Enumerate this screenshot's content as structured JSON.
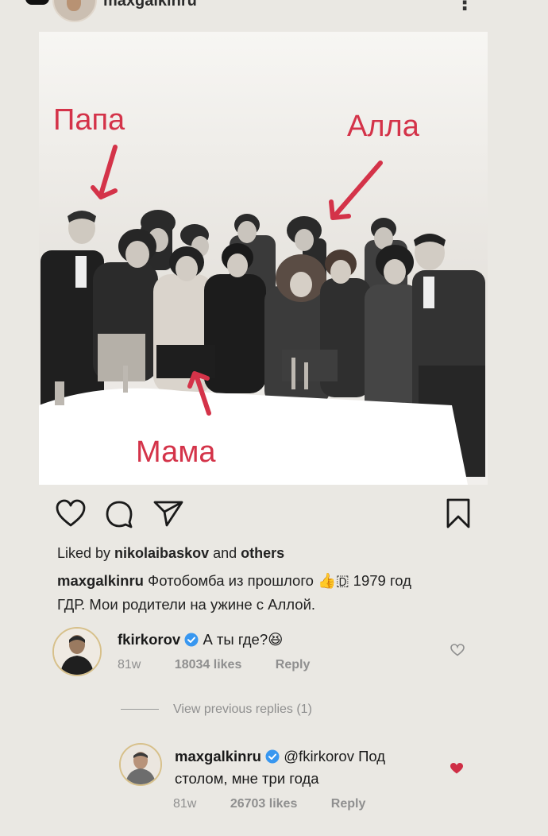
{
  "header": {
    "username": "maxgalkinru",
    "more_icon": "three-dots-vertical-icon",
    "more_label": "⋮"
  },
  "photo": {
    "labels": {
      "papa": "Папа",
      "alla": "Алла",
      "mama": "Мама"
    },
    "label_color": "#d43349"
  },
  "actions": {
    "like_icon": "heart-outline-icon",
    "comment_icon": "comment-bubble-icon",
    "share_icon": "paper-plane-icon",
    "save_icon": "bookmark-icon"
  },
  "post": {
    "liked_prefix": "Liked by ",
    "liked_user": "nikolaibaskov",
    "liked_middle": " and ",
    "liked_suffix": "others",
    "caption_user": "maxgalkinru",
    "caption_text_1": " Фотобомба из прошлого ",
    "caption_emoji": "👍",
    "caption_text_2": "🇩 1979 год",
    "caption_text_3": "ГДР. Мои родители на ужине с Аллой."
  },
  "comments": [
    {
      "user": "fkirkorov",
      "verified": true,
      "text": " А ты где?",
      "emoji": "😆",
      "age": "81w",
      "likes": "18034 likes",
      "reply": "Reply",
      "liked": false
    },
    {
      "user": "maxgalkinru",
      "verified": true,
      "mention": "@fkirkorov",
      "text_1": " Под",
      "text_2": "столом, мне три года",
      "age": "81w",
      "likes": "26703 likes",
      "reply": "Reply",
      "liked": true
    }
  ],
  "view_previous": "View previous replies (1)",
  "colors": {
    "background": "#eae8e3",
    "verified": "#3897f0",
    "liked_heart": "#cf2e45",
    "muted": "#8f8f8f"
  }
}
